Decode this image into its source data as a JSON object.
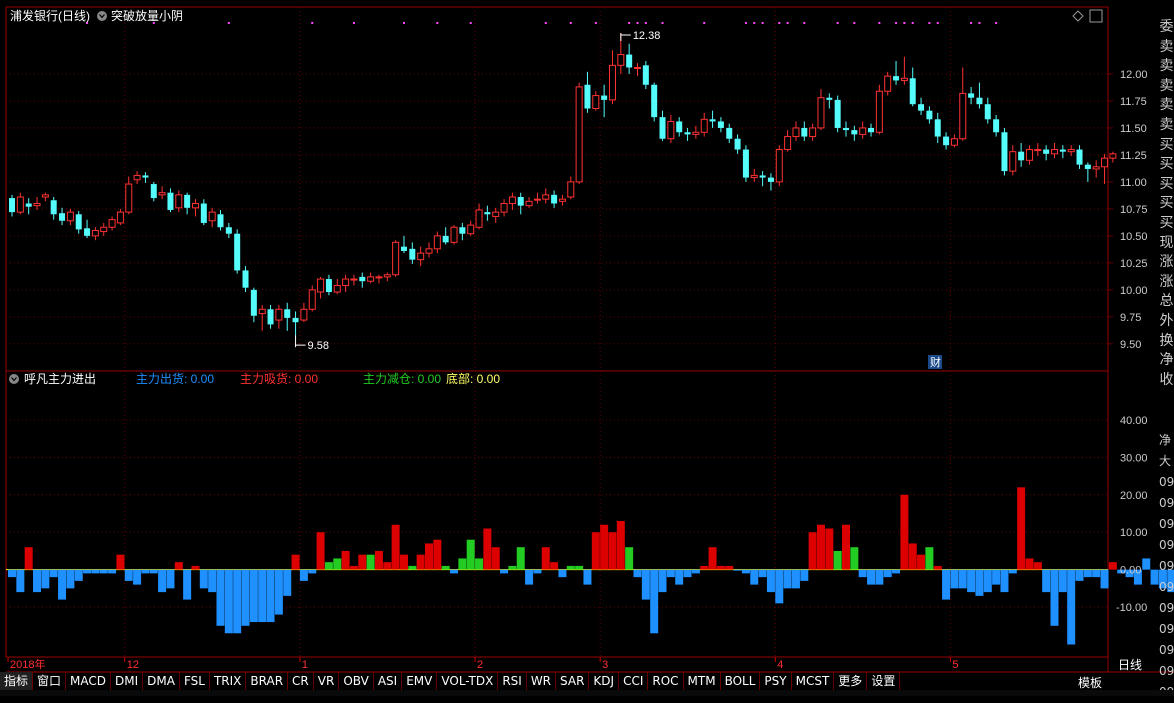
{
  "window": {
    "stock_title": "浦发银行(日线)",
    "indicator_title": "突破放量小阴",
    "sub_title": "呼凡主力进出"
  },
  "legend": {
    "out_label": "主力出货: 0.00",
    "buy_label": "主力吸货: 0.00",
    "reduce_label": "主力减仓: 0.00",
    "bottom_label": "底部: 0.00"
  },
  "price_markers": {
    "high": "12.38",
    "low": "9.58",
    "finance_badge": "财"
  },
  "date_axis": [
    {
      "label": "2018年",
      "index": 0
    },
    {
      "label": "12",
      "index": 14
    },
    {
      "label": "1",
      "index": 35
    },
    {
      "label": "2",
      "index": 56
    },
    {
      "label": "3",
      "index": 71
    },
    {
      "label": "4",
      "index": 92
    },
    {
      "label": "5",
      "index": 113
    }
  ],
  "price_axis": [
    "12.00",
    "11.75",
    "11.50",
    "11.25",
    "11.00",
    "10.75",
    "10.50",
    "10.25",
    "10.00",
    "9.75",
    "9.50"
  ],
  "sub_axis": [
    "40.00",
    "30.00",
    "20.00",
    "10.00",
    "0.00",
    "-10.00"
  ],
  "tabs": [
    "指标",
    "窗口",
    "MACD",
    "DMI",
    "DMA",
    "FSL",
    "TRIX",
    "BRAR",
    "CR",
    "VR",
    "OBV",
    "ASI",
    "EMV",
    "VOL-TDX",
    "RSI",
    "WR",
    "SAR",
    "KDJ",
    "CCI",
    "ROC",
    "MTM",
    "BOLL",
    "PSY",
    "MCST",
    "更多",
    "设置"
  ],
  "right_panel": [
    "委",
    "卖",
    "卖",
    "卖",
    "卖",
    "卖",
    "买",
    "买",
    "买",
    "买",
    "买",
    "现",
    "涨",
    "涨",
    "总",
    "外",
    "换",
    "净",
    "收"
  ],
  "right_panel_lower": [
    "净",
    "大",
    "09",
    "09",
    "09",
    "09",
    "09",
    "09",
    "09",
    "09",
    "09",
    "09",
    "09"
  ],
  "bottom_right": {
    "period": "日线",
    "template": "模板"
  },
  "colors": {
    "up": "#ff3232",
    "down": "#54fcfc",
    "out_bar": "#1e90ff",
    "buy_bar": "#dd0000",
    "reduce_bar": "#22cc22",
    "grid": "#660000",
    "axis_text": "#cccccc",
    "marker_pink": "#ff44ff"
  },
  "chart_data": {
    "type": "candlestick",
    "price_ylim": [
      9.35,
      12.5
    ],
    "sub_ylim": [
      -22,
      48
    ],
    "candles": [
      [
        10.85,
        10.72,
        10.88,
        10.68
      ],
      [
        10.72,
        10.86,
        10.9,
        10.7
      ],
      [
        10.8,
        10.77,
        10.85,
        10.7
      ],
      [
        10.78,
        10.8,
        10.86,
        10.74
      ],
      [
        10.86,
        10.88,
        10.9,
        10.82
      ],
      [
        10.83,
        10.7,
        10.86,
        10.65
      ],
      [
        10.71,
        10.64,
        10.76,
        10.6
      ],
      [
        10.64,
        10.72,
        10.75,
        10.6
      ],
      [
        10.7,
        10.56,
        10.73,
        10.52
      ],
      [
        10.57,
        10.5,
        10.65,
        10.48
      ],
      [
        10.5,
        10.55,
        10.58,
        10.46
      ],
      [
        10.54,
        10.58,
        10.62,
        10.5
      ],
      [
        10.58,
        10.65,
        10.68,
        10.55
      ],
      [
        10.62,
        10.72,
        10.75,
        10.6
      ],
      [
        10.72,
        10.98,
        11.05,
        10.7
      ],
      [
        11.02,
        11.06,
        11.1,
        10.98
      ],
      [
        11.06,
        11.04,
        11.09,
        10.99
      ],
      [
        10.98,
        10.85,
        11.0,
        10.82
      ],
      [
        10.88,
        10.9,
        10.96,
        10.84
      ],
      [
        10.9,
        10.74,
        10.94,
        10.72
      ],
      [
        10.76,
        10.88,
        10.92,
        10.72
      ],
      [
        10.88,
        10.76,
        10.9,
        10.7
      ],
      [
        10.76,
        10.8,
        10.84,
        10.68
      ],
      [
        10.8,
        10.62,
        10.84,
        10.6
      ],
      [
        10.64,
        10.72,
        10.76,
        10.58
      ],
      [
        10.7,
        10.58,
        10.74,
        10.55
      ],
      [
        10.58,
        10.52,
        10.62,
        10.48
      ],
      [
        10.52,
        10.18,
        10.56,
        10.15
      ],
      [
        10.18,
        10.02,
        10.22,
        9.98
      ],
      [
        10.0,
        9.76,
        10.02,
        9.7
      ],
      [
        9.78,
        9.82,
        9.86,
        9.62
      ],
      [
        9.82,
        9.68,
        9.86,
        9.64
      ],
      [
        9.72,
        9.82,
        9.86,
        9.64
      ],
      [
        9.82,
        9.74,
        9.88,
        9.62
      ],
      [
        9.74,
        9.7,
        9.8,
        9.58
      ],
      [
        9.72,
        9.82,
        9.88,
        9.7
      ],
      [
        9.82,
        10.0,
        10.04,
        9.8
      ],
      [
        9.98,
        10.1,
        10.12,
        9.92
      ],
      [
        10.1,
        9.98,
        10.14,
        9.95
      ],
      [
        9.98,
        10.04,
        10.1,
        9.96
      ],
      [
        10.04,
        10.1,
        10.14,
        9.98
      ],
      [
        10.1,
        10.1,
        10.14,
        10.04
      ],
      [
        10.12,
        10.08,
        10.16,
        10.02
      ],
      [
        10.08,
        10.12,
        10.16,
        10.06
      ],
      [
        10.12,
        10.12,
        10.14,
        10.06
      ],
      [
        10.12,
        10.14,
        10.16,
        10.08
      ],
      [
        10.14,
        10.44,
        10.46,
        10.12
      ],
      [
        10.4,
        10.36,
        10.5,
        10.34
      ],
      [
        10.38,
        10.28,
        10.44,
        10.24
      ],
      [
        10.28,
        10.34,
        10.4,
        10.22
      ],
      [
        10.34,
        10.38,
        10.44,
        10.3
      ],
      [
        10.38,
        10.5,
        10.54,
        10.34
      ],
      [
        10.5,
        10.44,
        10.58,
        10.42
      ],
      [
        10.44,
        10.58,
        10.6,
        10.42
      ],
      [
        10.58,
        10.52,
        10.62,
        10.46
      ],
      [
        10.52,
        10.6,
        10.64,
        10.5
      ],
      [
        10.58,
        10.74,
        10.8,
        10.56
      ],
      [
        10.72,
        10.7,
        10.78,
        10.64
      ],
      [
        10.68,
        10.72,
        10.76,
        10.62
      ],
      [
        10.72,
        10.8,
        10.84,
        10.68
      ],
      [
        10.8,
        10.86,
        10.9,
        10.74
      ],
      [
        10.86,
        10.78,
        10.9,
        10.7
      ],
      [
        10.78,
        10.82,
        10.86,
        10.76
      ],
      [
        10.84,
        10.84,
        10.9,
        10.8
      ],
      [
        10.84,
        10.88,
        10.94,
        10.8
      ],
      [
        10.88,
        10.8,
        10.92,
        10.76
      ],
      [
        10.82,
        10.84,
        10.88,
        10.78
      ],
      [
        10.86,
        11.0,
        11.05,
        10.84
      ],
      [
        11.0,
        11.88,
        11.92,
        10.98
      ],
      [
        11.9,
        11.68,
        12.02,
        11.64
      ],
      [
        11.68,
        11.8,
        11.84,
        11.66
      ],
      [
        11.8,
        11.76,
        11.9,
        11.6
      ],
      [
        11.76,
        12.08,
        12.22,
        11.72
      ],
      [
        12.08,
        12.18,
        12.38,
        12.0
      ],
      [
        12.18,
        12.06,
        12.28,
        12.0
      ],
      [
        12.06,
        12.06,
        12.1,
        11.98
      ],
      [
        12.08,
        11.9,
        12.12,
        11.86
      ],
      [
        11.9,
        11.6,
        11.92,
        11.56
      ],
      [
        11.6,
        11.4,
        11.66,
        11.38
      ],
      [
        11.4,
        11.56,
        11.62,
        11.36
      ],
      [
        11.56,
        11.46,
        11.6,
        11.42
      ],
      [
        11.46,
        11.44,
        11.5,
        11.38
      ],
      [
        11.44,
        11.46,
        11.52,
        11.4
      ],
      [
        11.46,
        11.58,
        11.64,
        11.42
      ],
      [
        11.58,
        11.56,
        11.66,
        11.5
      ],
      [
        11.56,
        11.5,
        11.6,
        11.46
      ],
      [
        11.5,
        11.4,
        11.54,
        11.36
      ],
      [
        11.4,
        11.3,
        11.44,
        11.26
      ],
      [
        11.3,
        11.04,
        11.34,
        11.0
      ],
      [
        11.04,
        11.06,
        11.12,
        11.0
      ],
      [
        11.06,
        11.04,
        11.1,
        10.96
      ],
      [
        11.04,
        11.0,
        11.08,
        10.92
      ],
      [
        11.0,
        11.3,
        11.34,
        10.96
      ],
      [
        11.3,
        11.42,
        11.48,
        11.28
      ],
      [
        11.42,
        11.5,
        11.56,
        11.38
      ],
      [
        11.5,
        11.42,
        11.56,
        11.38
      ],
      [
        11.42,
        11.5,
        11.54,
        11.38
      ],
      [
        11.5,
        11.78,
        11.86,
        11.48
      ],
      [
        11.78,
        11.76,
        11.82,
        11.68
      ],
      [
        11.76,
        11.5,
        11.8,
        11.46
      ],
      [
        11.5,
        11.48,
        11.56,
        11.42
      ],
      [
        11.48,
        11.44,
        11.52,
        11.38
      ],
      [
        11.44,
        11.5,
        11.56,
        11.4
      ],
      [
        11.5,
        11.46,
        11.54,
        11.42
      ],
      [
        11.46,
        11.84,
        11.9,
        11.44
      ],
      [
        11.84,
        11.98,
        12.02,
        11.8
      ],
      [
        11.98,
        11.94,
        12.12,
        11.9
      ],
      [
        11.94,
        11.96,
        12.16,
        11.9
      ],
      [
        11.96,
        11.72,
        12.06,
        11.7
      ],
      [
        11.72,
        11.66,
        11.78,
        11.62
      ],
      [
        11.66,
        11.58,
        11.7,
        11.54
      ],
      [
        11.58,
        11.42,
        11.64,
        11.36
      ],
      [
        11.42,
        11.34,
        11.46,
        11.3
      ],
      [
        11.34,
        11.4,
        11.44,
        11.32
      ],
      [
        11.4,
        11.82,
        12.06,
        11.38
      ],
      [
        11.82,
        11.78,
        11.88,
        11.72
      ],
      [
        11.78,
        11.72,
        11.92,
        11.68
      ],
      [
        11.72,
        11.58,
        11.78,
        11.54
      ],
      [
        11.58,
        11.46,
        11.62,
        11.42
      ],
      [
        11.46,
        11.1,
        11.5,
        11.06
      ],
      [
        11.1,
        11.28,
        11.34,
        11.06
      ],
      [
        11.28,
        11.2,
        11.36,
        11.14
      ],
      [
        11.2,
        11.3,
        11.34,
        11.16
      ],
      [
        11.3,
        11.3,
        11.36,
        11.24
      ],
      [
        11.3,
        11.26,
        11.34,
        11.2
      ],
      [
        11.26,
        11.3,
        11.36,
        11.22
      ],
      [
        11.3,
        11.28,
        11.34,
        11.22
      ],
      [
        11.28,
        11.3,
        11.34,
        11.24
      ],
      [
        11.3,
        11.16,
        11.34,
        11.12
      ],
      [
        11.16,
        11.12,
        11.18,
        11.0
      ],
      [
        11.12,
        11.14,
        11.2,
        11.04
      ],
      [
        11.14,
        11.22,
        11.26,
        10.98
      ],
      [
        11.22,
        11.26,
        11.28,
        11.18
      ]
    ],
    "sub_values": [
      -2,
      -6,
      6,
      -6,
      -5,
      -2,
      -8,
      -5,
      -3,
      -1,
      -1,
      -1,
      -1,
      4,
      -3,
      -4,
      -1,
      -1,
      -6,
      -5,
      2,
      -8,
      1,
      -5,
      -6,
      -15,
      -17,
      -17,
      -15,
      -14,
      -14,
      -14,
      -12,
      -7,
      4,
      -3,
      -1,
      10,
      2,
      3,
      5,
      1,
      4,
      4,
      5,
      2,
      12,
      4,
      1,
      4,
      7,
      8,
      1,
      -1,
      3,
      8,
      3,
      11,
      6,
      -1,
      1,
      6,
      -4,
      -1,
      6,
      2,
      -2,
      1,
      1,
      -4,
      10,
      12,
      10,
      13,
      6,
      -2,
      -8,
      -17,
      -6,
      -2,
      -4,
      -2,
      -1,
      1,
      6,
      1,
      1,
      0,
      -1,
      -4,
      -2,
      -6,
      -9,
      -5,
      -5,
      -3,
      10,
      12,
      11,
      5,
      12,
      6,
      -2,
      -4,
      -4,
      -2,
      -1,
      20,
      7,
      4,
      6,
      1,
      -8,
      -5,
      -5,
      -6,
      -7,
      -6,
      -4,
      -6,
      -1,
      22,
      3,
      2,
      -6,
      -15,
      -6,
      -20,
      -3,
      -2,
      -2,
      -5,
      2,
      -1,
      -2,
      -4,
      3,
      -4,
      -5,
      -6,
      -2,
      3,
      3
    ],
    "sub_kind": [
      "o",
      "o",
      "b",
      "o",
      "o",
      "o",
      "o",
      "o",
      "o",
      "o",
      "o",
      "o",
      "o",
      "b",
      "o",
      "o",
      "o",
      "o",
      "o",
      "o",
      "b",
      "o",
      "b",
      "o",
      "o",
      "o",
      "o",
      "o",
      "o",
      "o",
      "o",
      "o",
      "o",
      "o",
      "b",
      "o",
      "o",
      "b",
      "g",
      "g",
      "b",
      "b",
      "b",
      "g",
      "b",
      "b",
      "b",
      "b",
      "g",
      "b",
      "b",
      "b",
      "g",
      "o",
      "g",
      "g",
      "g",
      "b",
      "b",
      "o",
      "g",
      "g",
      "o",
      "o",
      "b",
      "b",
      "o",
      "g",
      "g",
      "o",
      "b",
      "b",
      "b",
      "b",
      "g",
      "o",
      "o",
      "o",
      "o",
      "o",
      "o",
      "o",
      "o",
      "b",
      "b",
      "b",
      "b",
      "o",
      "o",
      "o",
      "o",
      "o",
      "o",
      "o",
      "o",
      "o",
      "b",
      "b",
      "b",
      "g",
      "b",
      "g",
      "o",
      "o",
      "o",
      "o",
      "o",
      "b",
      "b",
      "b",
      "g",
      "b",
      "o",
      "o",
      "o",
      "o",
      "o",
      "o",
      "o",
      "o",
      "o",
      "b",
      "b",
      "b",
      "o",
      "o",
      "o",
      "o",
      "o",
      "o",
      "o",
      "o",
      "b",
      "o",
      "o",
      "o",
      "o",
      "o",
      "o",
      "o",
      "b",
      "b"
    ]
  }
}
